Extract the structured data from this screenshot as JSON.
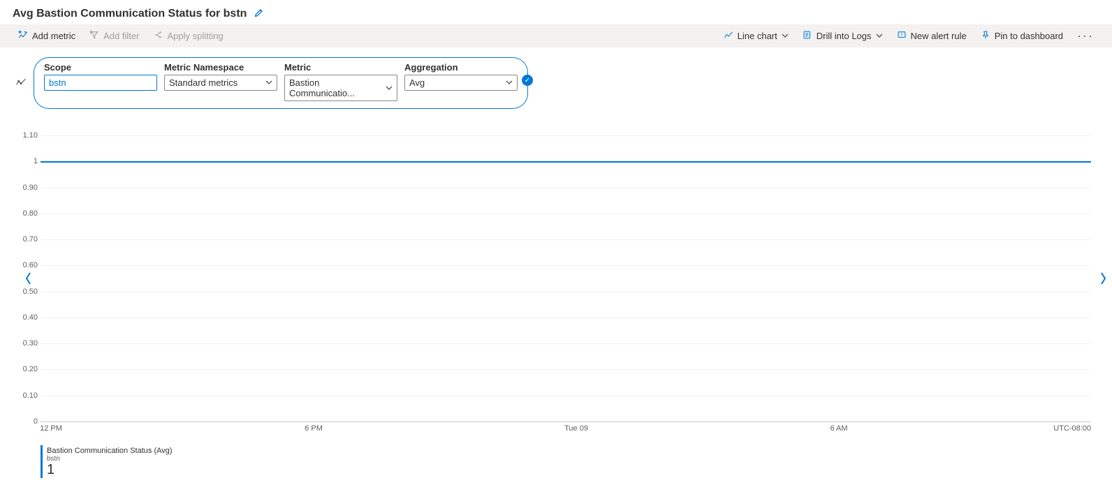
{
  "title": "Avg Bastion Communication Status for bstn",
  "toolbar": {
    "add_metric": "Add metric",
    "add_filter": "Add filter",
    "apply_splitting": "Apply splitting",
    "line_chart": "Line chart",
    "drill_into_logs": "Drill into Logs",
    "new_alert_rule": "New alert rule",
    "pin_to_dashboard": "Pin to dashboard"
  },
  "selector": {
    "scope_label": "Scope",
    "scope_value": "bstn",
    "namespace_label": "Metric Namespace",
    "namespace_value": "Standard metrics",
    "metric_label": "Metric",
    "metric_value": "Bastion Communicatio...",
    "aggregation_label": "Aggregation",
    "aggregation_value": "Avg"
  },
  "chart_data": {
    "type": "line",
    "title": "Avg Bastion Communication Status for bstn",
    "xlabel": "",
    "ylabel": "",
    "ylim": [
      0,
      1.1
    ],
    "y_ticks": [
      "0",
      "0.10",
      "0.20",
      "0.30",
      "0.40",
      "0.50",
      "0.60",
      "0.70",
      "0.80",
      "0.90",
      "1",
      "1.10"
    ],
    "x_ticks": [
      {
        "label": "12 PM",
        "frac": 0.01
      },
      {
        "label": "6 PM",
        "frac": 0.26
      },
      {
        "label": "Tue 09",
        "frac": 0.51
      },
      {
        "label": "6 AM",
        "frac": 0.76
      }
    ],
    "timezone": "UTC-08:00",
    "series": [
      {
        "name": "Bastion Communication Status (Avg)",
        "resource": "bstn",
        "color": "#0078d4",
        "constant_value": 1
      }
    ]
  },
  "legend": {
    "series_name": "Bastion Communication Status (Avg)",
    "series_resource": "bstn",
    "value": "1"
  }
}
